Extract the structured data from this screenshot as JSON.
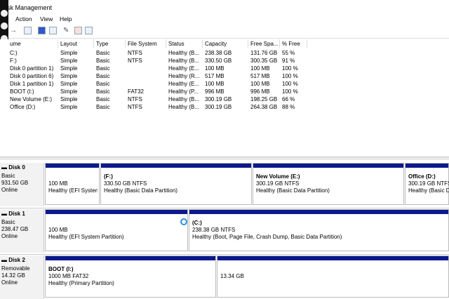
{
  "window": {
    "title": "isk Management"
  },
  "menu": {
    "action": "Action",
    "view": "View",
    "help": "Help"
  },
  "columns": {
    "volume": "ume",
    "layout": "Layout",
    "type": "Type",
    "fs": "File System",
    "status": "Status",
    "capacity": "Capacity",
    "free": "Free Spa...",
    "pfree": "% Free"
  },
  "volumes": [
    {
      "volume": "C:)",
      "layout": "Simple",
      "type": "Basic",
      "fs": "NTFS",
      "status": "Healthy (B...",
      "capacity": "238.38 GB",
      "free": "131.76 GB",
      "pfree": "55 %"
    },
    {
      "volume": "F:)",
      "layout": "Simple",
      "type": "Basic",
      "fs": "NTFS",
      "status": "Healthy (B...",
      "capacity": "330.50 GB",
      "free": "300.35 GB",
      "pfree": "91 %"
    },
    {
      "volume": "Disk 0 partition 1)",
      "layout": "Simple",
      "type": "Basic",
      "fs": "",
      "status": "Healthy (E...",
      "capacity": "100 MB",
      "free": "100 MB",
      "pfree": "100 %"
    },
    {
      "volume": "Disk 0 partition 6)",
      "layout": "Simple",
      "type": "Basic",
      "fs": "",
      "status": "Healthy (R...",
      "capacity": "517 MB",
      "free": "517 MB",
      "pfree": "100 %"
    },
    {
      "volume": "Disk 1 partition 1)",
      "layout": "Simple",
      "type": "Basic",
      "fs": "",
      "status": "Healthy (E...",
      "capacity": "100 MB",
      "free": "100 MB",
      "pfree": "100 %"
    },
    {
      "volume": "BOOT (I:)",
      "layout": "Simple",
      "type": "Basic",
      "fs": "FAT32",
      "status": "Healthy (P...",
      "capacity": "996 MB",
      "free": "996 MB",
      "pfree": "100 %"
    },
    {
      "volume": "New Volume (E:)",
      "layout": "Simple",
      "type": "Basic",
      "fs": "NTFS",
      "status": "Healthy (B...",
      "capacity": "300.19 GB",
      "free": "198.25 GB",
      "pfree": "66 %"
    },
    {
      "volume": "Office (D:)",
      "layout": "Simple",
      "type": "Basic",
      "fs": "NTFS",
      "status": "Healthy (B...",
      "capacity": "300.19 GB",
      "free": "264.38 GB",
      "pfree": "88 %"
    }
  ],
  "disks": [
    {
      "name": "Disk 0",
      "type": "Basic",
      "size": "931.50 GB",
      "state": "Online",
      "partitions": [
        {
          "name": "",
          "size": "100 MB",
          "status": "Healthy (EFI System"
        },
        {
          "name": "(F:)",
          "size": "330.50 GB NTFS",
          "status": "Healthy (Basic Data Partition)"
        },
        {
          "name": "New Volume  (E:)",
          "size": "300.19 GB NTFS",
          "status": "Healthy (Basic Data Partition)"
        },
        {
          "name": "Office  (D:)",
          "size": "300.19 GB NTFS",
          "status": "Healthy (Basic Da"
        }
      ]
    },
    {
      "name": "Disk 1",
      "type": "Basic",
      "size": "238.47 GB",
      "state": "Online",
      "partitions": [
        {
          "name": "",
          "size": "100 MB",
          "status": "Healthy (EFI System Partition)"
        },
        {
          "name": "(C:)",
          "size": "238.38 GB NTFS",
          "status": "Healthy (Boot, Page File, Crash Dump, Basic Data Partition)"
        }
      ]
    },
    {
      "name": "Disk 2",
      "type": "Removable",
      "size": "14.32 GB",
      "state": "Online",
      "partitions": [
        {
          "name": "BOOT  (I:)",
          "size": "1000 MB FAT32",
          "status": "Healthy (Primary Partition)"
        },
        {
          "name": "",
          "size": "13.34 GB",
          "status": ""
        }
      ]
    }
  ]
}
